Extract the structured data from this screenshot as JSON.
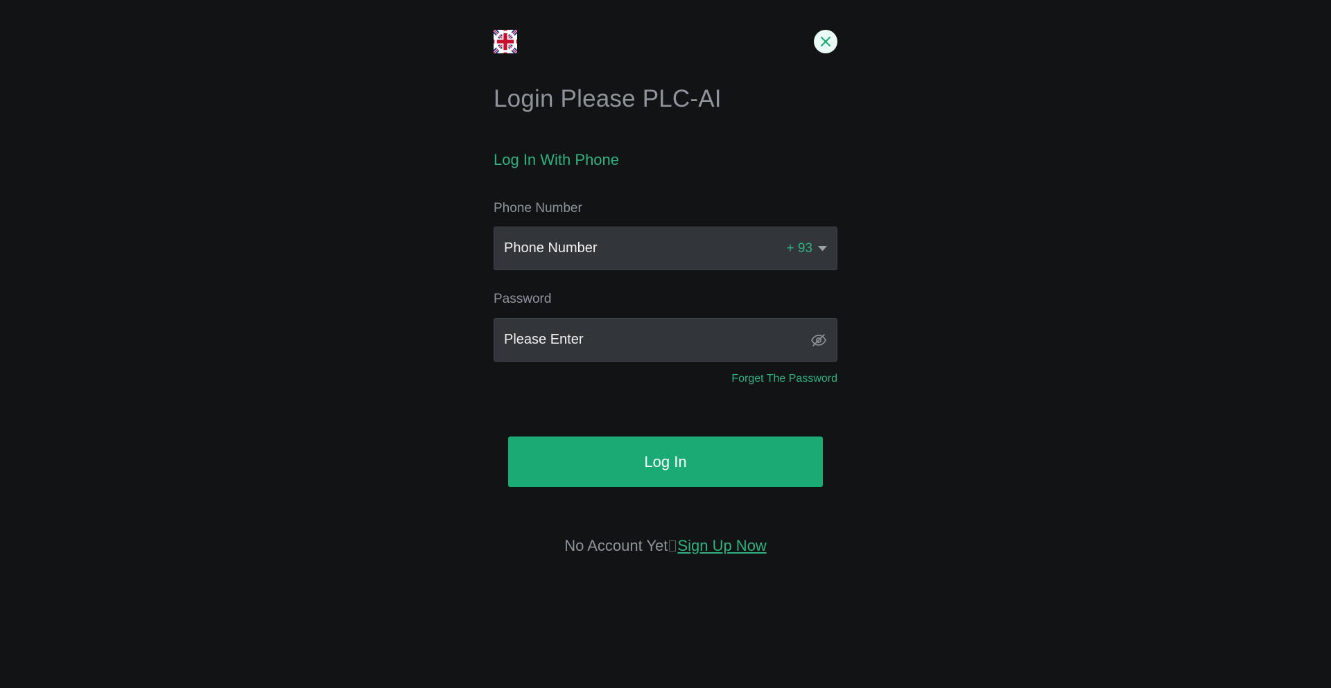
{
  "header": {
    "language_flag_icon": "uk-flag-icon",
    "close_icon": "close-icon"
  },
  "title": "Login Please PLC-AI",
  "login_method_tab": "Log In With Phone",
  "phone": {
    "label": "Phone Number",
    "placeholder": "Phone Number",
    "value": "",
    "country_code": "+ 93",
    "dropdown_icon": "caret-down-icon"
  },
  "password": {
    "label": "Password",
    "placeholder": "Please Enter",
    "value": "",
    "visibility_icon": "eye-off-icon"
  },
  "forgot_password": "Forget The Password",
  "login_button": "Log In",
  "signup": {
    "prompt": "No Account Yet",
    "link": "Sign Up Now"
  },
  "colors": {
    "background": "#111315",
    "accent": "#1aab74",
    "accent_text": "#2fb27f",
    "input_bg": "#32363b",
    "muted_text": "#8f949c"
  }
}
